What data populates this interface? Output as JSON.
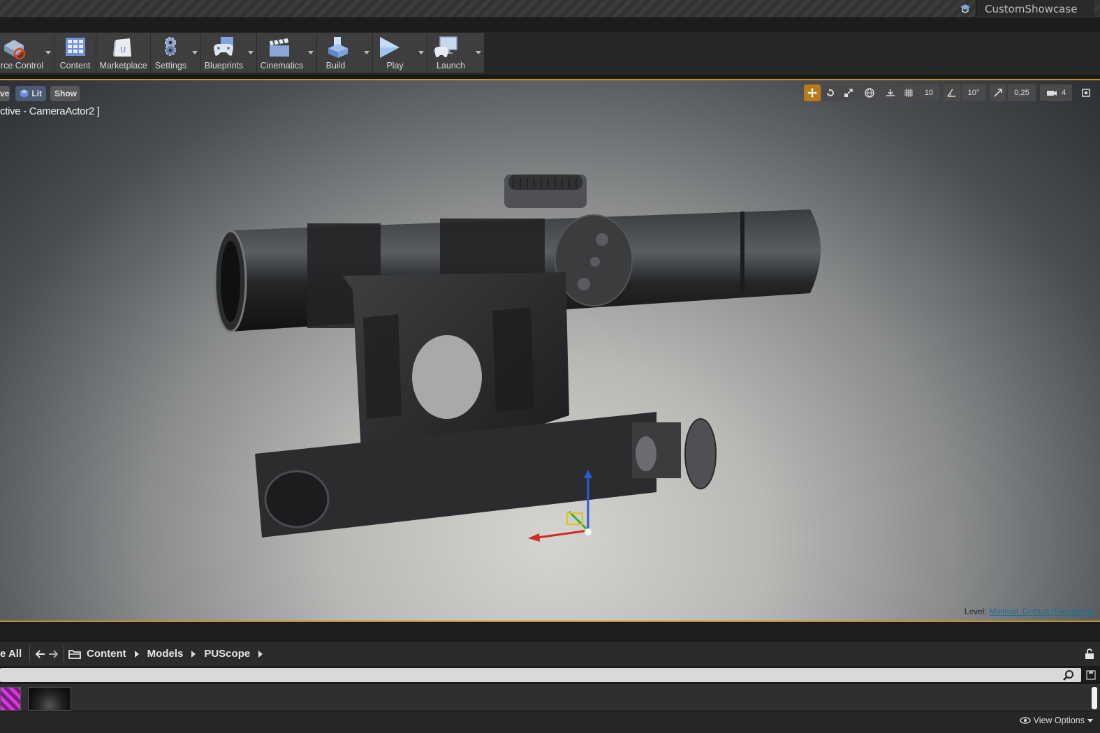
{
  "titlebar": {
    "project_name": "CustomShowcase"
  },
  "toolbar": {
    "buttons": [
      {
        "label": "rce Control",
        "icon": "source-control-icon"
      },
      {
        "label": "Content",
        "icon": "content-grid-icon"
      },
      {
        "label": "Marketplace",
        "icon": "marketplace-bag-icon"
      },
      {
        "label": "Settings",
        "icon": "settings-gears-icon"
      },
      {
        "label": "Blueprints",
        "icon": "blueprints-gamepad-icon"
      },
      {
        "label": "Cinematics",
        "icon": "clapperboard-icon"
      },
      {
        "label": "Build",
        "icon": "build-blocks-icon"
      },
      {
        "label": "Play",
        "icon": "play-icon"
      },
      {
        "label": "Launch",
        "icon": "launch-monitor-icon"
      }
    ]
  },
  "viewport": {
    "left_pills": {
      "perspective": "ve",
      "lit": "Lit",
      "show": "Show"
    },
    "camera_label": "ctive - CameraActor2 ]",
    "tools": {
      "grid_snap": "10",
      "rotation_snap": "10°",
      "scale_snap": "0,25",
      "camera_speed": "4"
    },
    "level_prefix": "Level:",
    "level_name": "Minimal_Default (Persistent)"
  },
  "content_browser": {
    "save_all": "e All",
    "path": [
      "Content",
      "Models",
      "PUScope"
    ]
  },
  "footer": {
    "view_options": "View Options"
  },
  "colors": {
    "accent": "#c8902a",
    "viewport_bg": "#8a8c8d",
    "level_link": "#1e6f9a"
  }
}
